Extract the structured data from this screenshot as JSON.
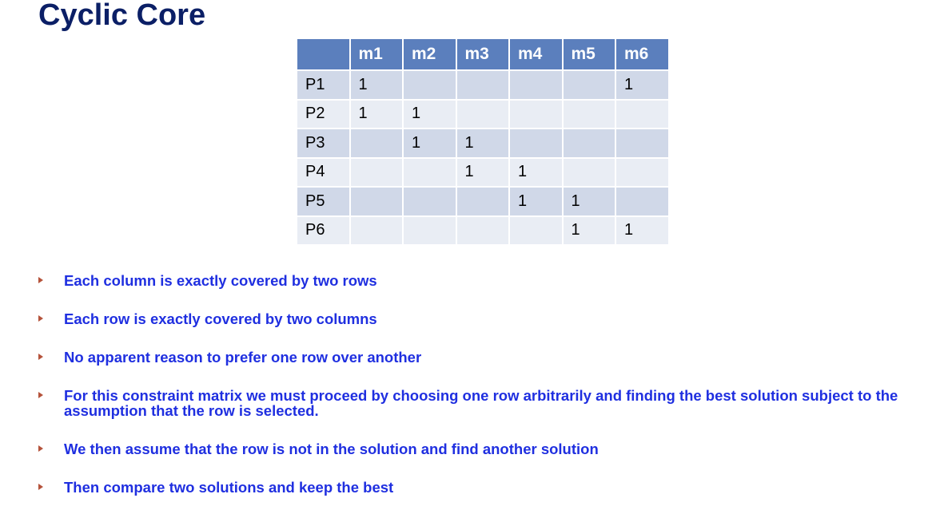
{
  "slide": {
    "title": "Cyclic Core"
  },
  "matrix": {
    "columns": [
      "",
      "m1",
      "m2",
      "m3",
      "m4",
      "m5",
      "m6"
    ],
    "rows": [
      {
        "label": "P1",
        "cells": [
          "1",
          "",
          "",
          "",
          "",
          "1"
        ]
      },
      {
        "label": "P2",
        "cells": [
          "1",
          "1",
          "",
          "",
          "",
          ""
        ]
      },
      {
        "label": "P3",
        "cells": [
          "",
          "1",
          "1",
          "",
          "",
          ""
        ]
      },
      {
        "label": "P4",
        "cells": [
          "",
          "",
          "1",
          "1",
          "",
          ""
        ]
      },
      {
        "label": "P5",
        "cells": [
          "",
          "",
          "",
          "1",
          "1",
          ""
        ]
      },
      {
        "label": "P6",
        "cells": [
          "",
          "",
          "",
          "",
          "1",
          "1"
        ]
      }
    ]
  },
  "bullets": [
    "Each column is exactly covered by two rows",
    "Each row is exactly covered by two columns",
    "No apparent reason to prefer one row over another",
    "For this constraint matrix we must proceed by choosing one row arbitrarily and finding the best solution subject to the assumption that the row is selected.",
    "We then assume that the row is not in the solution and find another solution",
    "Then compare two solutions and keep the best"
  ],
  "colors": {
    "title": "#0b1f66",
    "header_bg": "#5b7fbd",
    "row_odd_bg": "#d0d8e8",
    "row_even_bg": "#e9edf4",
    "bullet_text": "#1f2fe0",
    "bullet_marker": "#b5533b"
  }
}
